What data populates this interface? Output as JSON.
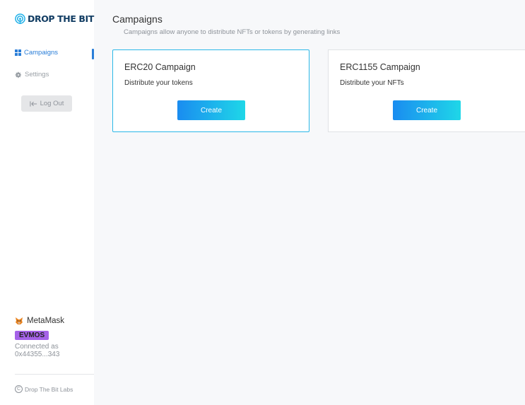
{
  "app": {
    "logo_text": "DROP THE BIT",
    "logo_icon": "signal-drop-icon"
  },
  "sidebar": {
    "items": [
      {
        "label": "Campaigns",
        "icon": "grid-icon",
        "active": true
      },
      {
        "label": "Settings",
        "icon": "gear-icon",
        "active": false
      }
    ],
    "logout_label": "Log Out"
  },
  "wallet": {
    "name": "MetaMask",
    "network": "EVMOS",
    "connected_label": "Connected as",
    "address": "0x44355...343"
  },
  "footer": {
    "label": "Drop The Bit Labs"
  },
  "page": {
    "title": "Campaigns",
    "subtitle": "Campaigns allow anyone to distribute NFTs or tokens by generating links"
  },
  "cards": [
    {
      "title": "ERC20 Campaign",
      "description": "Distribute your tokens",
      "button_label": "Create"
    },
    {
      "title": "ERC1155 Campaign",
      "description": "Distribute your NFTs",
      "button_label": "Create"
    }
  ],
  "colors": {
    "accent": "#2a7ed8",
    "active_card_border": "#2bb8e8",
    "network_badge": "#a562e8",
    "button_gradient_start": "#1a8cf0",
    "button_gradient_end": "#1fd7e8"
  }
}
